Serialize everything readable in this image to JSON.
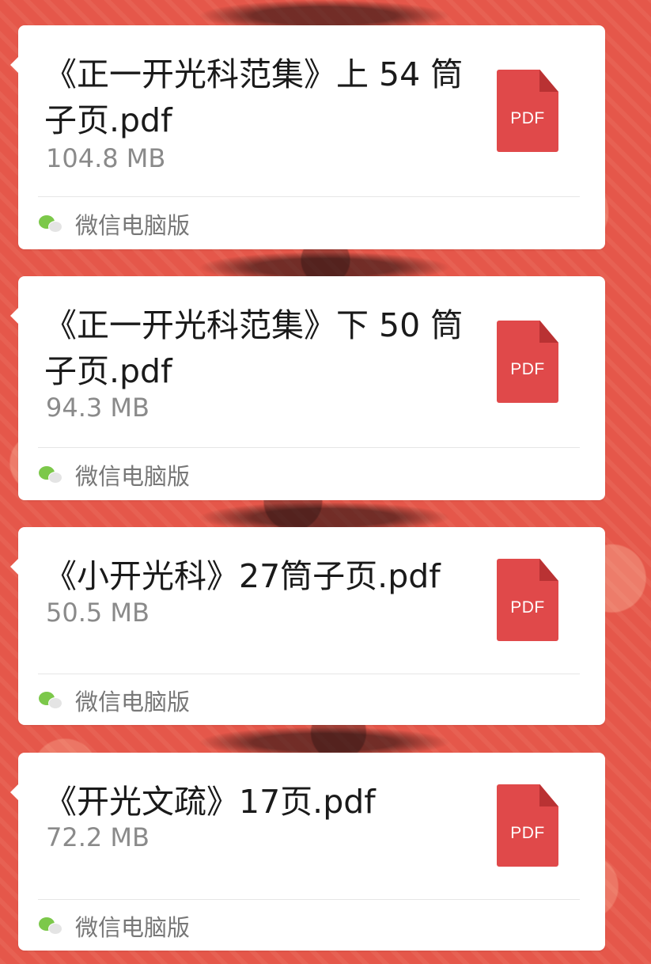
{
  "messages": [
    {
      "file_name": "《正一开光科范集》上 54 筒子页.pdf",
      "size": "104.8 MB",
      "source": "微信电脑版",
      "icon_label": "PDF"
    },
    {
      "file_name": "《正一开光科范集》下 50 筒子页.pdf",
      "size": "94.3 MB",
      "source": "微信电脑版",
      "icon_label": "PDF"
    },
    {
      "file_name": "《小开光科》27筒子页.pdf",
      "size": "50.5 MB",
      "source": "微信电脑版",
      "icon_label": "PDF"
    },
    {
      "file_name": "《开光文疏》17页.pdf",
      "size": "72.2 MB",
      "source": "微信电脑版",
      "icon_label": "PDF"
    }
  ]
}
